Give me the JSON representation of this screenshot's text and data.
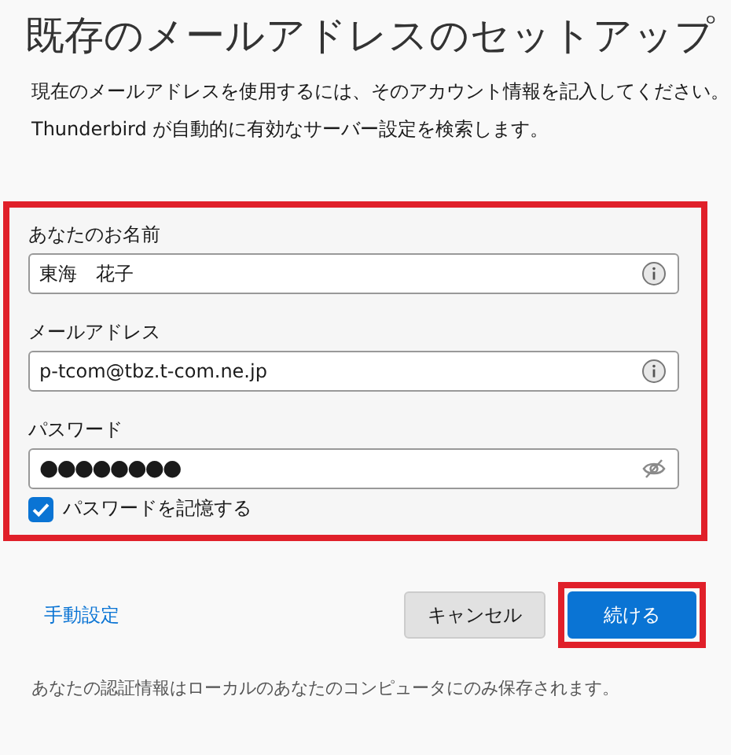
{
  "title": "既存のメールアドレスのセットアップ",
  "description": [
    "現在のメールアドレスを使用するには、そのアカウント情報を記入してください。",
    "Thunderbird が自動的に有効なサーバー設定を検索します。"
  ],
  "form": {
    "highlighted": true,
    "fields": [
      {
        "label": "あなたのお名前",
        "value": "東海　花子",
        "kind": "text"
      },
      {
        "label": "メールアドレス",
        "value": "p-tcom@tbz.t-com.ne.jp",
        "kind": "text"
      },
      {
        "label": "パスワード",
        "value": "●●●●●●●●",
        "kind": "password"
      }
    ],
    "remember": {
      "label": "パスワードを記憶する",
      "checked": true
    }
  },
  "manual_link": "手動設定",
  "buttons": [
    {
      "label": "キャンセル",
      "kind": "secondary",
      "highlighted": false
    },
    {
      "label": "続ける",
      "kind": "primary",
      "highlighted": true
    }
  ],
  "footer": "あなたの認証情報はローカルのあなたのコンピュータにのみ保存されます。"
}
